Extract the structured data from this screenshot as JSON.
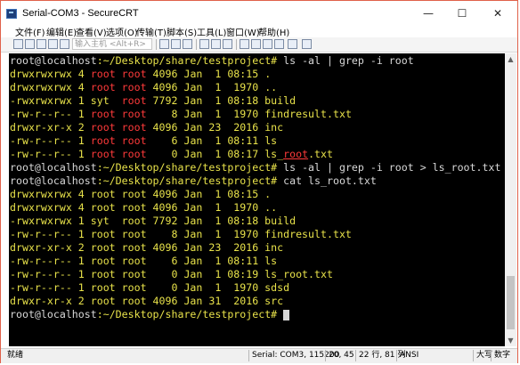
{
  "window": {
    "title": "Serial-COM3 - SecureCRT",
    "minimize_glyph": "—",
    "maximize_glyph": "☐",
    "close_glyph": "✕"
  },
  "menu": [
    {
      "label": "文件(F)"
    },
    {
      "label": "编辑(E)"
    },
    {
      "label": "查看(V)"
    },
    {
      "label": "选项(O)"
    },
    {
      "label": "传输(T)"
    },
    {
      "label": "脚本(S)"
    },
    {
      "label": "工具(L)"
    },
    {
      "label": "窗口(W)"
    },
    {
      "label": "帮助(H)"
    }
  ],
  "toolbar": {
    "host_placeholder": "输入主机 <Alt+R>"
  },
  "terminal": {
    "lines": [
      [
        {
          "t": "root@localhost",
          "c": "w"
        },
        {
          "t": ":~/Desktop/share/testproject# ",
          "c": "y"
        },
        {
          "t": "ls -al | grep -i root",
          "c": "w"
        }
      ],
      [
        {
          "t": "drwxrwxrwx 4 ",
          "c": "y"
        },
        {
          "t": "root root",
          "c": "r"
        },
        {
          "t": " 4096 Jan  1 08:15 .",
          "c": "y"
        }
      ],
      [
        {
          "t": "drwxrwxrwx 4 ",
          "c": "y"
        },
        {
          "t": "root root",
          "c": "r"
        },
        {
          "t": " 4096 Jan  1  1970 ..",
          "c": "y"
        }
      ],
      [
        {
          "t": "-rwxrwxrwx 1 syt  ",
          "c": "y"
        },
        {
          "t": "root",
          "c": "r"
        },
        {
          "t": " 7792 Jan  1 08:18 build",
          "c": "y"
        }
      ],
      [
        {
          "t": "-rw-r--r-- 1 ",
          "c": "y"
        },
        {
          "t": "root root",
          "c": "r"
        },
        {
          "t": "    8 Jan  1  1970 findresult.txt",
          "c": "y"
        }
      ],
      [
        {
          "t": "drwxr-xr-x 2 ",
          "c": "y"
        },
        {
          "t": "root root",
          "c": "r"
        },
        {
          "t": " 4096 Jan 23  2016 inc",
          "c": "y"
        }
      ],
      [
        {
          "t": "-rw-r--r-- 1 ",
          "c": "y"
        },
        {
          "t": "root root",
          "c": "r"
        },
        {
          "t": "    6 Jan  1 08:11 ls",
          "c": "y"
        }
      ],
      [
        {
          "t": "-rw-r--r-- 1 ",
          "c": "y"
        },
        {
          "t": "root root",
          "c": "r"
        },
        {
          "t": "    0 Jan  1 08:17 ls_",
          "c": "y"
        },
        {
          "t": "root",
          "c": "u"
        },
        {
          "t": ".txt",
          "c": "y"
        }
      ],
      [
        {
          "t": "root@localhost",
          "c": "w"
        },
        {
          "t": ":~/Desktop/share/testproject# ",
          "c": "y"
        },
        {
          "t": "ls -al | grep -i root > ls_root.txt",
          "c": "w"
        }
      ],
      [
        {
          "t": "root@localhost",
          "c": "w"
        },
        {
          "t": ":~/Desktop/share/testproject# ",
          "c": "y"
        },
        {
          "t": "cat ls_root.txt",
          "c": "w"
        }
      ],
      [
        {
          "t": "drwxrwxrwx 4 root root 4096 Jan  1 08:15 .",
          "c": "y"
        }
      ],
      [
        {
          "t": "drwxrwxrwx 4 root root 4096 Jan  1  1970 ..",
          "c": "y"
        }
      ],
      [
        {
          "t": "-rwxrwxrwx 1 syt  root 7792 Jan  1 08:18 build",
          "c": "y"
        }
      ],
      [
        {
          "t": "-rw-r--r-- 1 root root    8 Jan  1  1970 findresult.txt",
          "c": "y"
        }
      ],
      [
        {
          "t": "drwxr-xr-x 2 root root 4096 Jan 23  2016 inc",
          "c": "y"
        }
      ],
      [
        {
          "t": "-rw-r--r-- 1 root root    6 Jan  1 08:11 ls",
          "c": "y"
        }
      ],
      [
        {
          "t": "-rw-r--r-- 1 root root    0 Jan  1 08:19 ls_root.txt",
          "c": "y"
        }
      ],
      [
        {
          "t": "-rw-r--r-- 1 root root    0 Jan  1  1970 sdsd",
          "c": "y"
        }
      ],
      [
        {
          "t": "drwxr-xr-x 2 root root 4096 Jan 31  2016 src",
          "c": "y"
        }
      ],
      [
        {
          "t": "root@localhost",
          "c": "w"
        },
        {
          "t": ":~/Desktop/share/testproject# ",
          "c": "y"
        }
      ]
    ]
  },
  "statusbar": {
    "ready": "就绪",
    "connection": "Serial: COM3, 115200",
    "cursor": "20, 45",
    "size": "22 行, 81 列",
    "term_type": "ANSI",
    "caps": "大写",
    "num": "数字"
  }
}
